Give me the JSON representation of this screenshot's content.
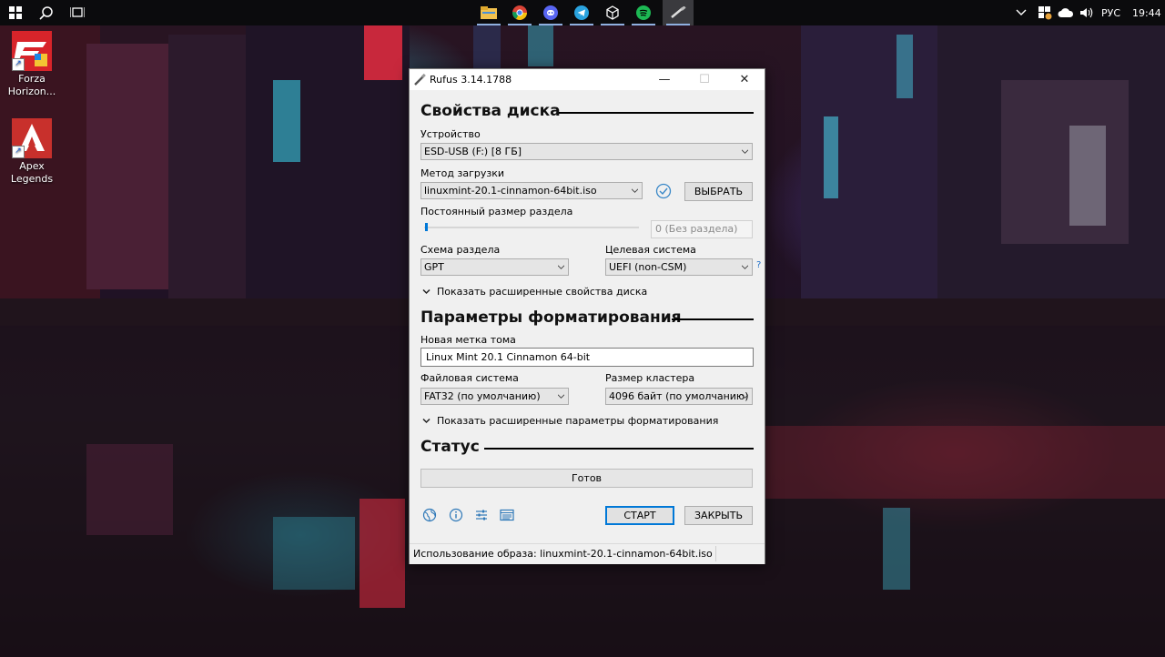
{
  "taskbar": {
    "icons": [
      "windows-start-icon",
      "search-icon",
      "task-view-icon"
    ],
    "apps": [
      "file-explorer-icon",
      "chrome-icon",
      "discord-icon",
      "telegram-icon",
      "app-cube-icon",
      "spotify-icon",
      "rufus-icon"
    ],
    "tray": {
      "chevron": "^",
      "language": "РУС",
      "clock": "19:44"
    }
  },
  "desktop_icons": [
    {
      "label": "Forza Horizon...",
      "icon": "forza-horizon-icon"
    },
    {
      "label": "Apex Legends",
      "icon": "apex-legends-icon"
    }
  ],
  "window": {
    "title": "Rufus 3.14.1788",
    "controls": {
      "minimize": "—",
      "maximize": "☐",
      "close": "✕"
    },
    "drive_section": {
      "heading": "Свойства диска",
      "device_label": "Устройство",
      "device_value": "ESD-USB (F:) [8 ГБ]",
      "boot_label": "Метод загрузки",
      "boot_value": "linuxmint-20.1-cinnamon-64bit.iso",
      "select_button": "ВЫБРАТЬ",
      "persistent_label": "Постоянный размер раздела",
      "persistent_value": "0 (Без раздела)",
      "persistent_fraction": 0,
      "partition_label": "Схема раздела",
      "partition_value": "GPT",
      "target_label": "Целевая система",
      "target_value": "UEFI (non-CSM)",
      "help": "?",
      "advanced_toggle": "Показать расширенные свойства диска"
    },
    "format_section": {
      "heading": "Параметры форматирования",
      "volume_label": "Новая метка тома",
      "volume_value": "Linux Mint 20.1 Cinnamon 64-bit",
      "fs_label": "Файловая система",
      "fs_value": "FAT32 (по умолчанию)",
      "cluster_label": "Размер кластера",
      "cluster_value": "4096 байт (по умолчанию)",
      "advanced_toggle": "Показать расширенные параметры форматирования"
    },
    "status_section": {
      "heading": "Статус",
      "status_text": "Готов",
      "progress": 0
    },
    "tools": [
      "globe-icon",
      "info-icon",
      "settings-sliders-icon",
      "log-icon"
    ],
    "start_button": "СТАРТ",
    "close_button": "ЗАКРЫТЬ",
    "statusbar_text": "Использование образа: linuxmint-20.1-cinnamon-64bit.iso"
  },
  "colors": {
    "accent": "#0078d7",
    "taskbar": "#0b0b0d",
    "window_bg": "#f0f0f0"
  }
}
